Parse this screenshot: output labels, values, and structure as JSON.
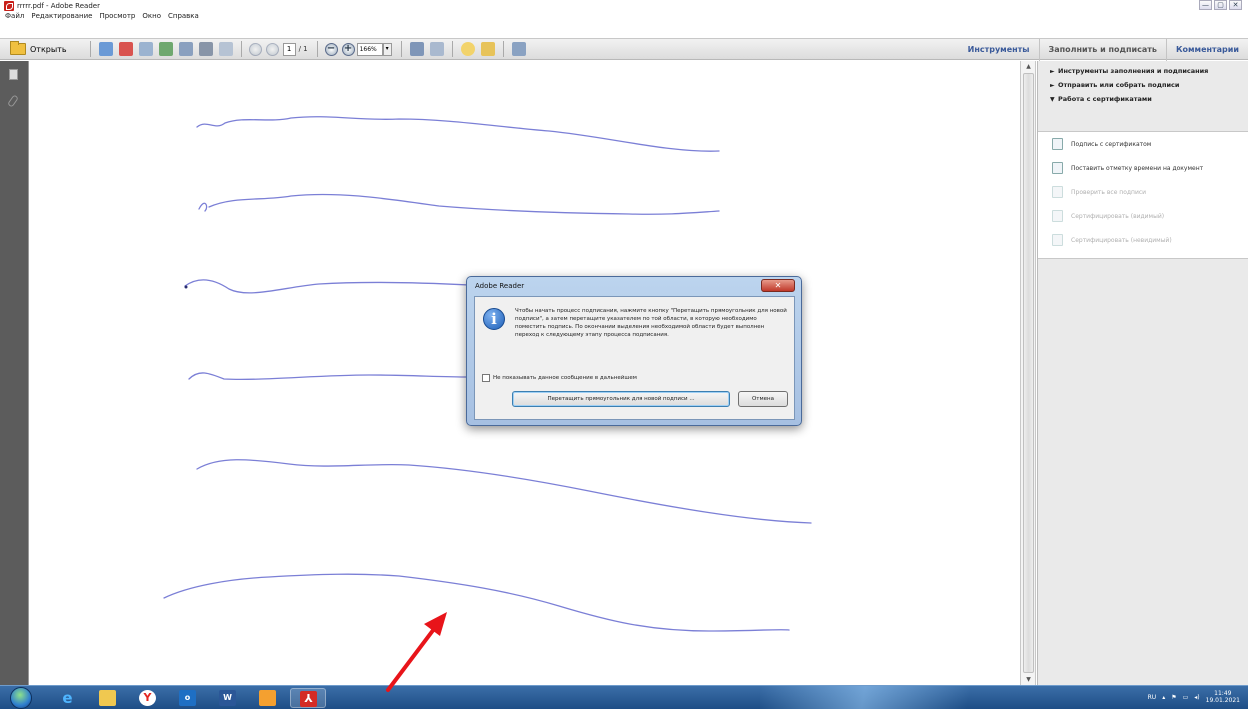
{
  "window": {
    "title": "rrrrr.pdf - Adobe Reader",
    "controls": [
      "—",
      "▢",
      "✕"
    ]
  },
  "menu": [
    "Файл",
    "Редактирование",
    "Просмотр",
    "Окно",
    "Справка"
  ],
  "toolbar": {
    "open_label": "Открыть",
    "page_current": "1",
    "page_total": "/ 1",
    "zoom": "166%",
    "zoom_drop": "▾",
    "zoom_out": "−",
    "zoom_in": "+"
  },
  "right_tabs": {
    "tools": "Инструменты",
    "fill_sign": "Заполнить и подписать",
    "comment": "Комментарии"
  },
  "panel": {
    "sections": [
      {
        "tri": "►",
        "label": "Инструменты заполнения и подписания"
      },
      {
        "tri": "►",
        "label": "Отправить или собрать подписи"
      },
      {
        "tri": "▼",
        "label": "Работа с сертификатами"
      }
    ],
    "items": [
      {
        "label": "Подпись с сертификатом",
        "enabled": true
      },
      {
        "label": "Поставить отметку времени на документ",
        "enabled": true
      },
      {
        "label": "Проверить все подписи",
        "enabled": false
      },
      {
        "label": "Сертифицировать (видимый)",
        "enabled": false
      },
      {
        "label": "Сертифицировать (невидимый)",
        "enabled": false
      }
    ]
  },
  "dialog": {
    "title": "Adobe Reader",
    "close": "✕",
    "message": "Чтобы начать процесс подписания, нажмите кнопку \"Перетащить прямоугольник для новой подписи\", а затем перетащите указателем по той области, в которую необходимо поместить подпись. По окончании выделения необходимой области будет выполнен переход к следующему этапу процесса подписания.",
    "checkbox_label": "Не показывать данное сообщение в дальнейшем",
    "primary_button": "Перетащить прямоугольник для новой подписи ...",
    "cancel_button": "Отмена"
  },
  "taskbar": {
    "lang": "RU",
    "time": "11:49",
    "date": "19.01.2021"
  },
  "colors": {
    "ink": "#7b7fd6",
    "accent_tabs": "#3a5a9a",
    "annotation_arrow": "#e8141a"
  }
}
